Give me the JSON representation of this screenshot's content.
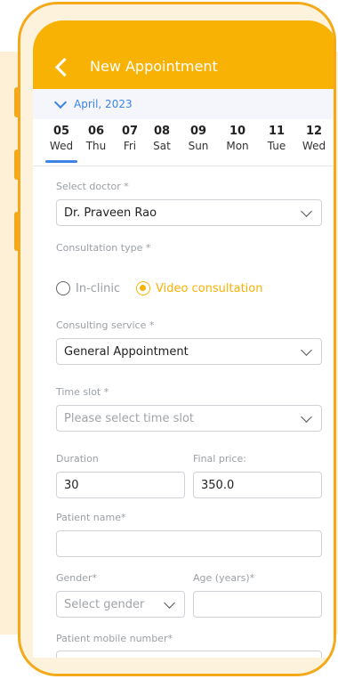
{
  "header": {
    "title": "New Appointment"
  },
  "calendar": {
    "month": "April, 2023",
    "days": [
      {
        "num": "05",
        "weekday": "Wed"
      },
      {
        "num": "06",
        "weekday": "Thu"
      },
      {
        "num": "07",
        "weekday": "Fri"
      },
      {
        "num": "08",
        "weekday": "Sat"
      },
      {
        "num": "09",
        "weekday": "Sun"
      },
      {
        "num": "10",
        "weekday": "Mon"
      },
      {
        "num": "11",
        "weekday": "Tue"
      },
      {
        "num": "12",
        "weekday": "Wed"
      }
    ],
    "selected_index": 0
  },
  "form": {
    "doctor": {
      "label": "Select doctor *",
      "value": "Dr. Praveen Rao"
    },
    "consultation_type": {
      "label": "Consultation type *",
      "options": [
        "In-clinic",
        "Video consultation"
      ],
      "selected": "Video consultation"
    },
    "service": {
      "label": "Consulting service *",
      "value": "General Appointment"
    },
    "time_slot": {
      "label": "Time slot *",
      "placeholder": "Please select time slot"
    },
    "duration": {
      "label": "Duration",
      "value": "30"
    },
    "final_price": {
      "label": "Final price:",
      "value": "350.0"
    },
    "patient_name": {
      "label": "Patient name*",
      "value": ""
    },
    "gender": {
      "label": "Gender*",
      "placeholder": "Select gender"
    },
    "age": {
      "label": "Age (years)*",
      "value": ""
    },
    "mobile": {
      "label": "Patient mobile number*",
      "value": ""
    }
  },
  "colors": {
    "accent": "#f8b204",
    "link": "#3d83e8",
    "frame": "#f3a91a"
  }
}
